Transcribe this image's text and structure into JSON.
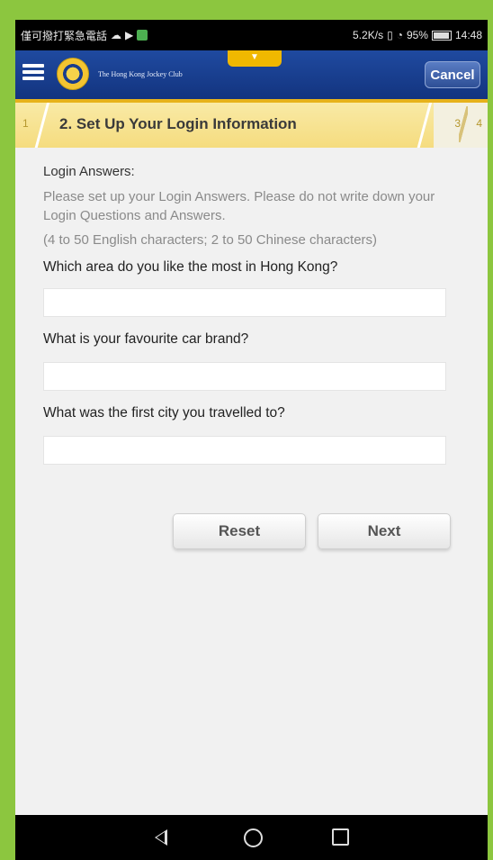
{
  "status_bar": {
    "left_text": "僅可撥打緊急電話",
    "right_text": "5.2K/s",
    "battery": "95%",
    "time": "14:48"
  },
  "header": {
    "club_name": "The Hong Kong Jockey Club",
    "cancel_label": "Cancel"
  },
  "steps": {
    "previous": "1",
    "current_title": "2. Set Up Your Login Information",
    "next": "3",
    "last": "4"
  },
  "form": {
    "section_label": "Login Answers:",
    "help_text": "Please set up your Login Answers. Please do not write down your Login Questions and Answers.",
    "hint_text": "(4 to 50 English characters; 2 to 50 Chinese characters)",
    "questions": [
      {
        "label": "Which area do you like the most in Hong Kong?",
        "value": ""
      },
      {
        "label": "What is your favourite car brand?",
        "value": ""
      },
      {
        "label": "What was the first city you travelled to?",
        "value": ""
      }
    ],
    "reset_label": "Reset",
    "next_label": "Next"
  }
}
